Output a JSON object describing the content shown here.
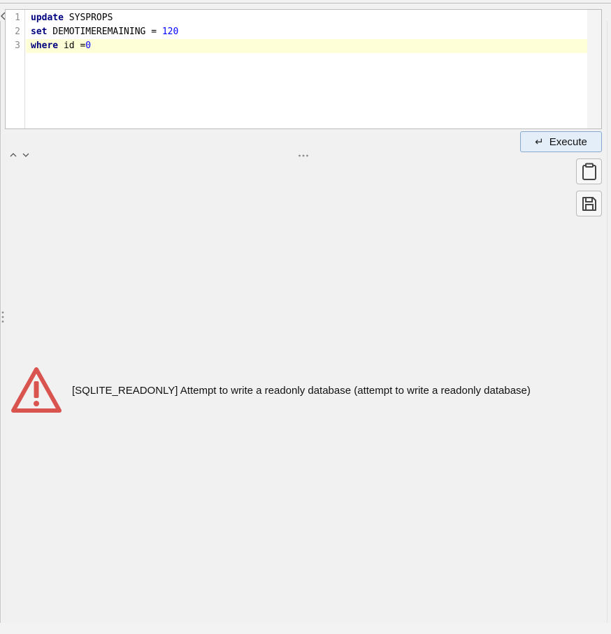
{
  "editor": {
    "lines": [
      {
        "number": "1",
        "keyword": "update",
        "rest": " SYSPROPS",
        "num": ""
      },
      {
        "number": "2",
        "keyword": "set",
        "rest": " DEMOTIMEREMAINING = ",
        "num": "120"
      },
      {
        "number": "3",
        "keyword": "where",
        "rest": " id =",
        "num": "0"
      }
    ],
    "current_line": 3,
    "colors": {
      "keyword": "#00007f",
      "number": "#0000ff",
      "current_line_bg": "#ffffd7"
    }
  },
  "toolbar": {
    "execute_label": "Execute",
    "execute_icon": "enter-arrow-icon"
  },
  "side_buttons": [
    {
      "icon": "clipboard-icon"
    },
    {
      "icon": "save-disk-icon"
    }
  ],
  "result": {
    "icon": "warning-triangle-icon",
    "icon_color": "#d9534f",
    "message": "[SQLITE_READONLY] Attempt to write a readonly database (attempt to write a readonly database)"
  }
}
